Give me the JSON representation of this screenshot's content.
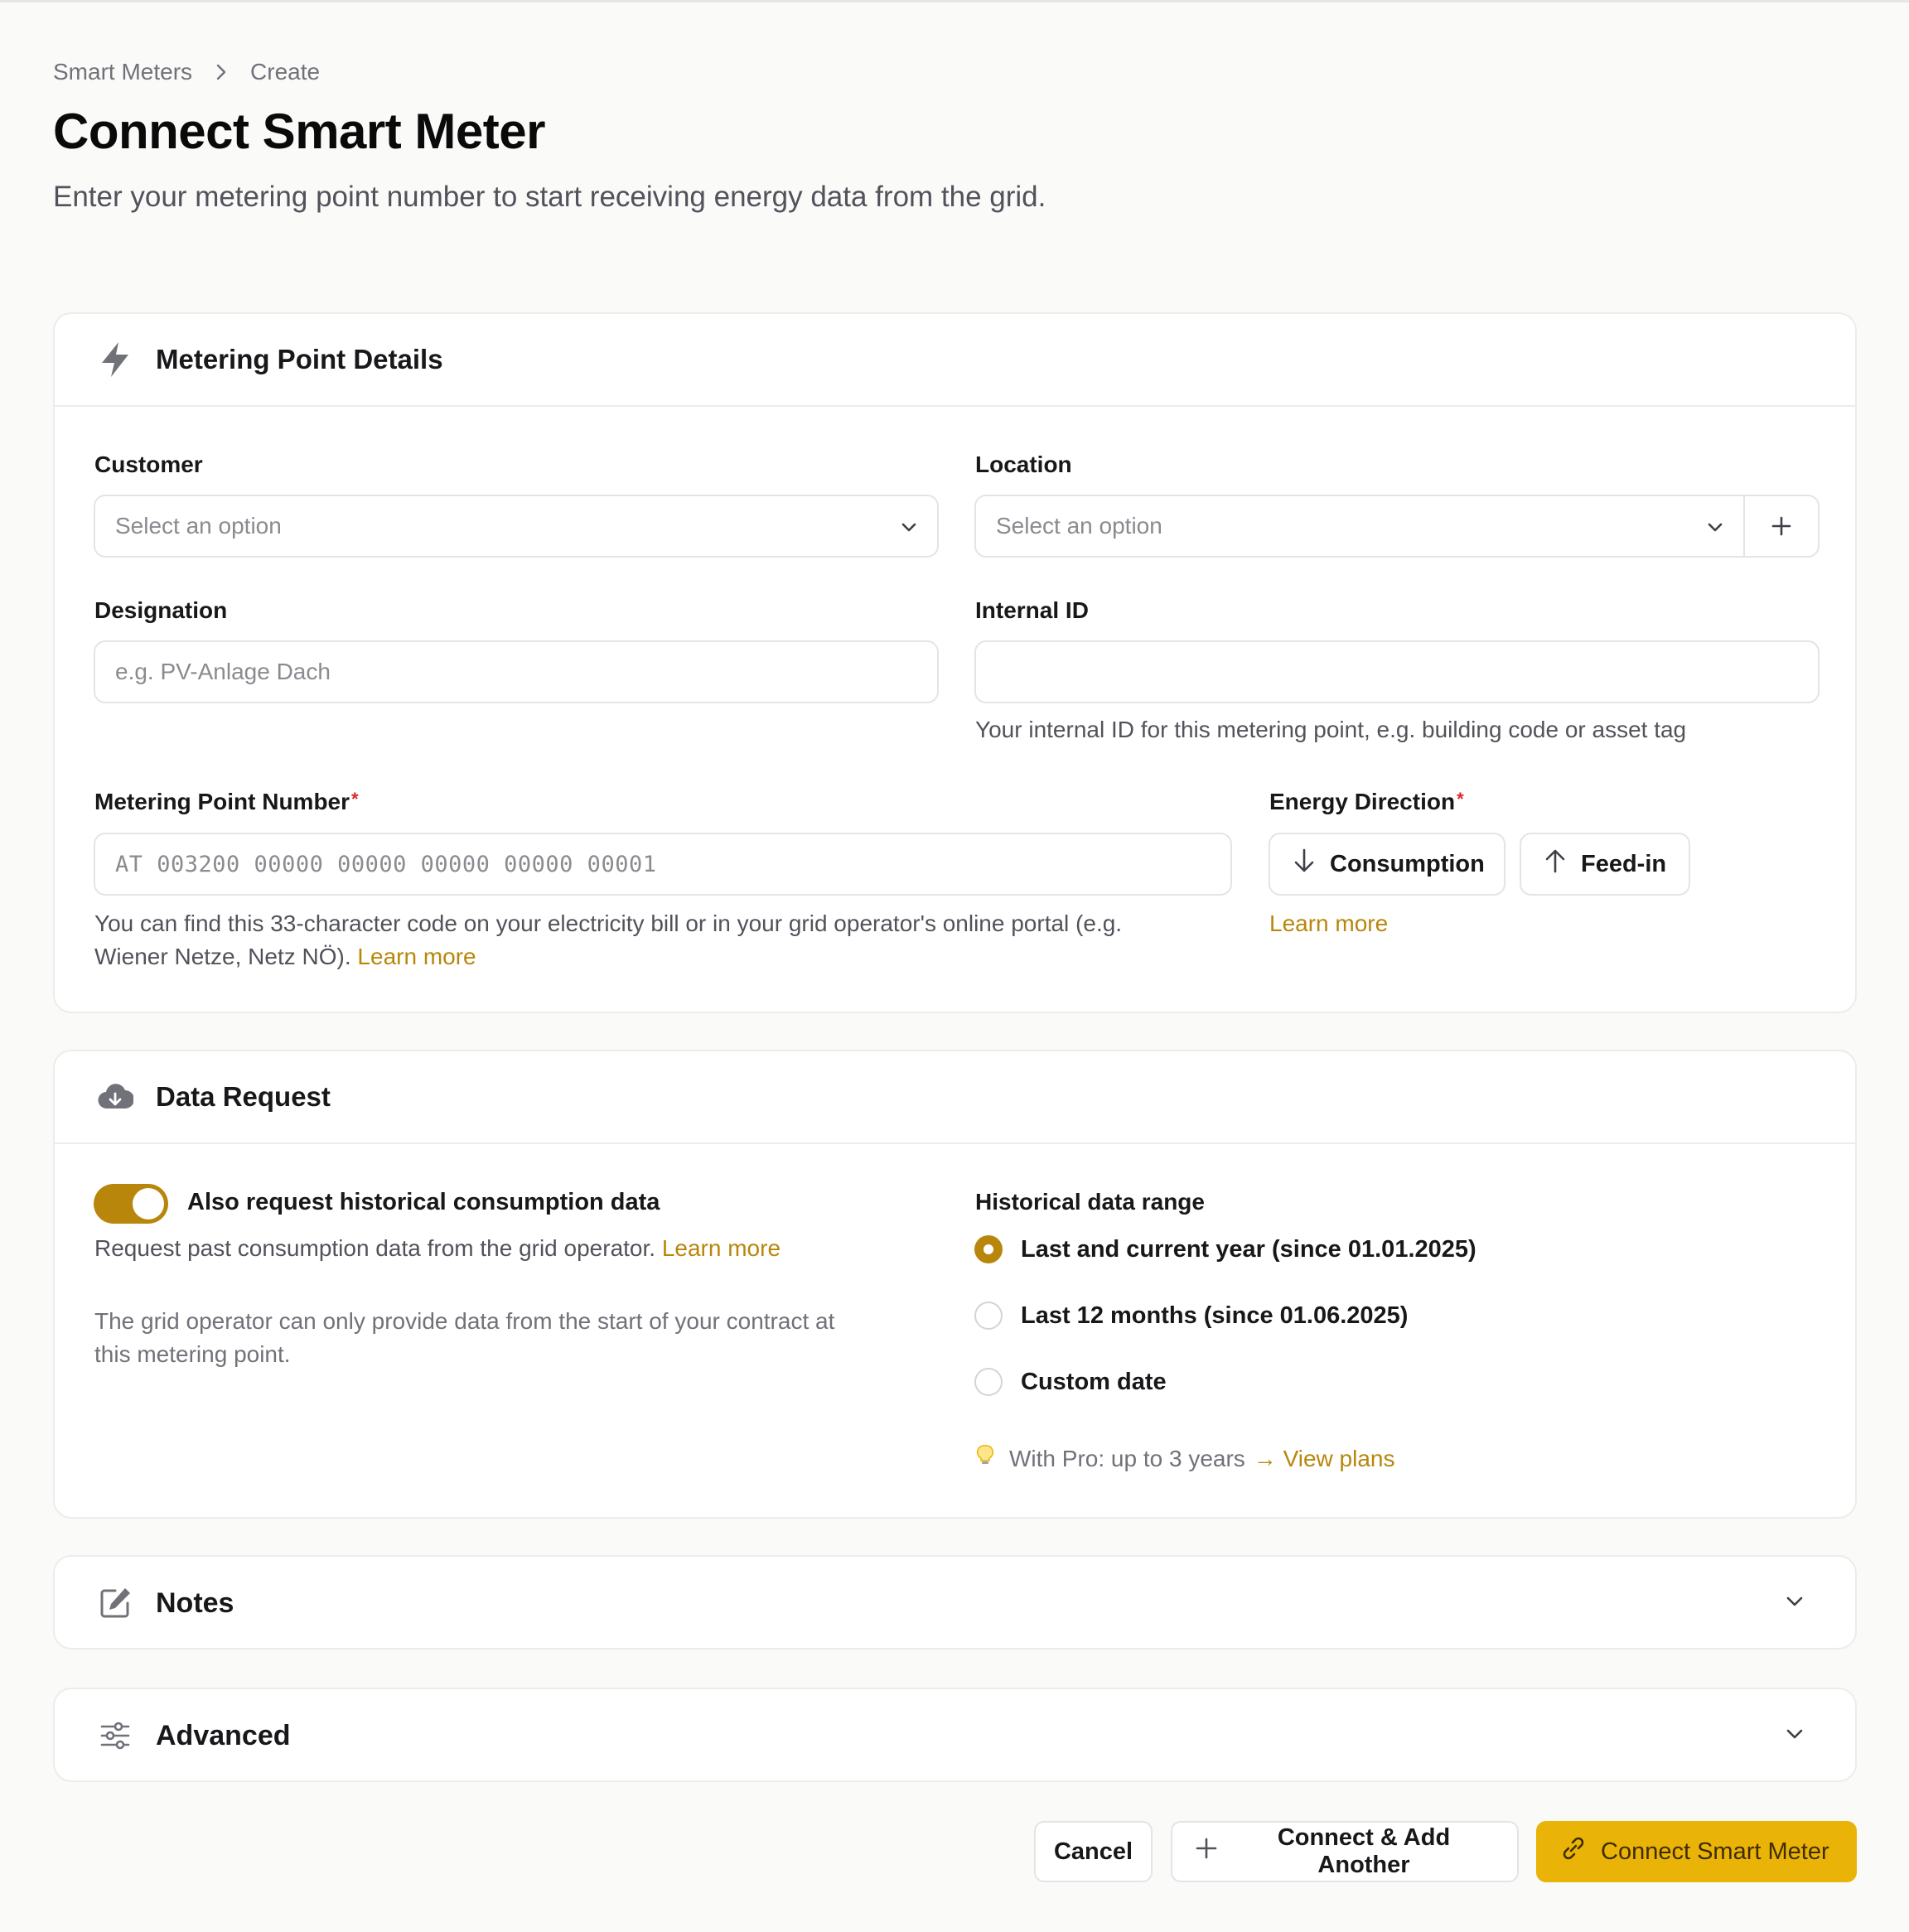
{
  "breadcrumb": {
    "items": [
      "Smart Meters",
      "Create"
    ]
  },
  "page": {
    "title": "Connect Smart Meter",
    "subtitle": "Enter your metering point number to start receiving energy data from the grid."
  },
  "metering": {
    "title": "Metering Point Details",
    "customer": {
      "label": "Customer",
      "placeholder": "Select an option"
    },
    "location": {
      "label": "Location",
      "placeholder": "Select an option"
    },
    "designation": {
      "label": "Designation",
      "placeholder": "e.g. PV-Anlage Dach"
    },
    "internal_id": {
      "label": "Internal ID",
      "value": "",
      "hint": "Your internal ID for this metering point, e.g. building code or asset tag"
    },
    "mpn": {
      "label": "Metering Point Number",
      "required": "*",
      "placeholder": "AT 003200 00000 00000 00000 00000 00001",
      "hint_line1": "You can find this 33-character code on your electricity bill or in your grid operator's online portal (e.g.",
      "hint_line2": "Wiener Netze, Netz NÖ).",
      "learn_more": "Learn more"
    },
    "direction": {
      "label": "Energy Direction",
      "required": "*",
      "options": [
        "Consumption",
        "Feed-in"
      ],
      "learn_more": "Learn more"
    }
  },
  "data_request": {
    "title": "Data Request",
    "toggle": {
      "label": "Also request historical consumption data",
      "on": true
    },
    "description": "Request past consumption data from the grid operator.",
    "learn_more": "Learn more",
    "note_line1": "The grid operator can only provide data from the start of your contract at",
    "note_line2": "this metering point.",
    "range": {
      "label": "Historical data range",
      "options": [
        {
          "label": "Last and current year (since 01.01.2025)",
          "selected": true
        },
        {
          "label": "Last 12 months (since 01.06.2025)",
          "selected": false
        },
        {
          "label": "Custom date",
          "selected": false
        }
      ]
    },
    "pro_note": "With Pro: up to 3 years",
    "view_plans": "→ View plans"
  },
  "notes": {
    "title": "Notes"
  },
  "advanced": {
    "title": "Advanced"
  },
  "footer": {
    "cancel": "Cancel",
    "connect_add": "Connect & Add Another",
    "connect": "Connect Smart Meter"
  },
  "colors": {
    "accent": "#b8860b",
    "primary_button": "#eab308",
    "required": "#dc2626"
  },
  "icons": [
    "chevron-right-icon",
    "bolt-icon",
    "chevron-down-icon",
    "plus-icon",
    "arrow-down-icon",
    "arrow-up-icon",
    "cloud-download-icon",
    "lightbulb-icon",
    "edit-icon",
    "sliders-icon",
    "link-icon"
  ]
}
